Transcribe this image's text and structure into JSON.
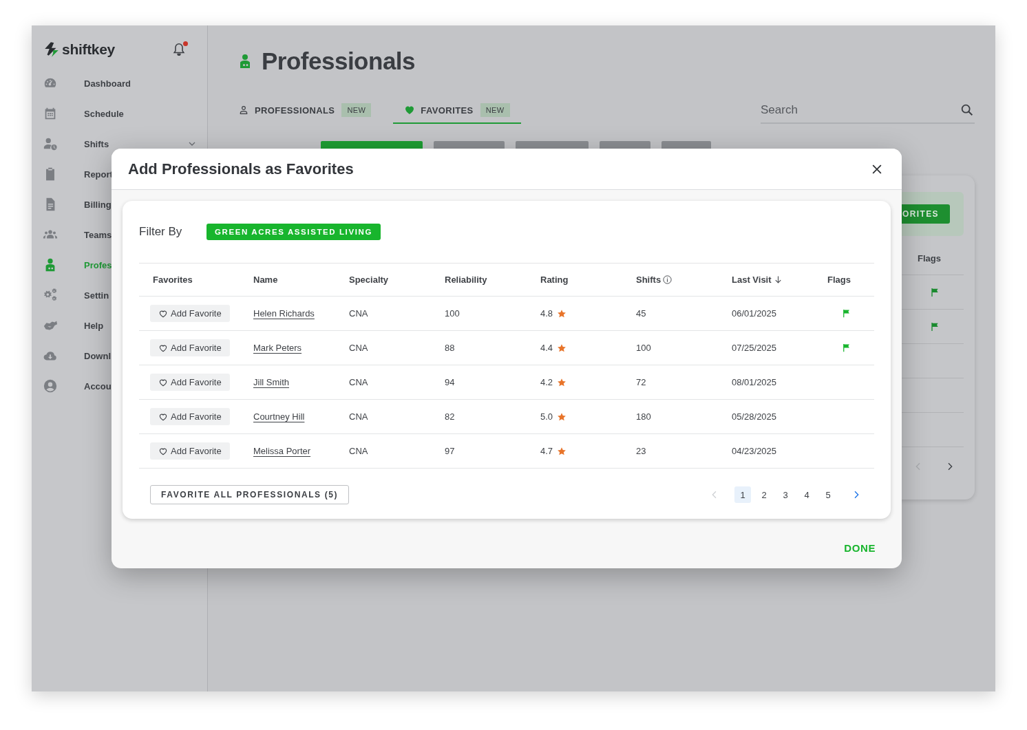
{
  "app": {
    "logo": "shiftkey",
    "notifications": {
      "unread": true
    }
  },
  "sidebar": {
    "items": [
      {
        "label": "Dashboard",
        "selected": false,
        "has_submenu": false
      },
      {
        "label": "Schedule",
        "selected": false,
        "has_submenu": false
      },
      {
        "label": "Shifts",
        "selected": false,
        "has_submenu": true
      },
      {
        "label": "Report",
        "selected": false,
        "has_submenu": false
      },
      {
        "label": "Billing",
        "selected": false,
        "has_submenu": false
      },
      {
        "label": "Teams",
        "selected": false,
        "has_submenu": false
      },
      {
        "label": "Profes",
        "selected": true,
        "has_submenu": false
      },
      {
        "label": "Settin",
        "selected": false,
        "has_submenu": false
      },
      {
        "label": "Help",
        "selected": false,
        "has_submenu": false
      },
      {
        "label": "Downl",
        "selected": false,
        "has_submenu": false
      },
      {
        "label": "Accou",
        "selected": false,
        "has_submenu": false
      }
    ]
  },
  "page": {
    "title": "Professionals"
  },
  "tabs": [
    {
      "label": "PROFESSIONALS",
      "badge": "NEW",
      "selected": false
    },
    {
      "label": "FAVORITES",
      "badge": "NEW",
      "selected": true
    }
  ],
  "search": {
    "placeholder": "Search"
  },
  "filter_bar": {
    "chips": [
      {
        "selected": true
      },
      {
        "selected": false
      },
      {
        "selected": false
      },
      {
        "selected": false
      },
      {
        "selected": false
      }
    ]
  },
  "background_card": {
    "button": "ORITES",
    "flags_header": "Flags",
    "rows": [
      {
        "flagged": true
      },
      {
        "flagged": true
      },
      {
        "flagged": false
      },
      {
        "flagged": false
      },
      {
        "flagged": false
      }
    ],
    "prev_disabled": true,
    "next_disabled": false
  },
  "dialog": {
    "title": "Add Professionals as Favorites",
    "filter_label": "Filter By",
    "filter_chip": "GREEN ACRES ASSISTED LIVING",
    "columns": [
      {
        "label": "Favorites",
        "info": false,
        "sorted_desc": false
      },
      {
        "label": "Name",
        "info": false,
        "sorted_desc": false
      },
      {
        "label": "Specialty",
        "info": false,
        "sorted_desc": false
      },
      {
        "label": "Reliability",
        "info": false,
        "sorted_desc": false
      },
      {
        "label": "Rating",
        "info": false,
        "sorted_desc": false
      },
      {
        "label": "Shifts",
        "info": true,
        "sorted_desc": false
      },
      {
        "label": "Last Visit",
        "info": false,
        "sorted_desc": true
      },
      {
        "label": "Flags",
        "info": false,
        "sorted_desc": false
      }
    ],
    "rows": [
      {
        "action": "Add Favorite",
        "name": "Helen Richards",
        "specialty": "CNA",
        "reliability": "100",
        "rating": "4.8",
        "shifts": "45",
        "last_visit": "06/01/2025",
        "flagged": true
      },
      {
        "action": "Add Favorite",
        "name": "Mark Peters",
        "specialty": "CNA",
        "reliability": "88",
        "rating": "4.4",
        "shifts": "100",
        "last_visit": "07/25/2025",
        "flagged": true
      },
      {
        "action": "Add Favorite",
        "name": "Jill Smith",
        "specialty": "CNA",
        "reliability": "94",
        "rating": "4.2",
        "shifts": "72",
        "last_visit": "08/01/2025",
        "flagged": false
      },
      {
        "action": "Add Favorite",
        "name": "Courtney Hill",
        "specialty": "CNA",
        "reliability": "82",
        "rating": "5.0",
        "shifts": "180",
        "last_visit": "05/28/2025",
        "flagged": false
      },
      {
        "action": "Add Favorite",
        "name": "Melissa Porter",
        "specialty": "CNA",
        "reliability": "97",
        "rating": "4.7",
        "shifts": "23",
        "last_visit": "04/23/2025",
        "flagged": false
      }
    ],
    "favorite_all": "FAVORITE ALL PROFESSIONALS (5)",
    "pages": [
      {
        "label": "1",
        "selected": true
      },
      {
        "label": "2",
        "selected": false
      },
      {
        "label": "3",
        "selected": false
      },
      {
        "label": "4",
        "selected": false
      },
      {
        "label": "5",
        "selected": false
      }
    ],
    "prev_disabled": true,
    "next_disabled": false,
    "done": "DONE"
  }
}
